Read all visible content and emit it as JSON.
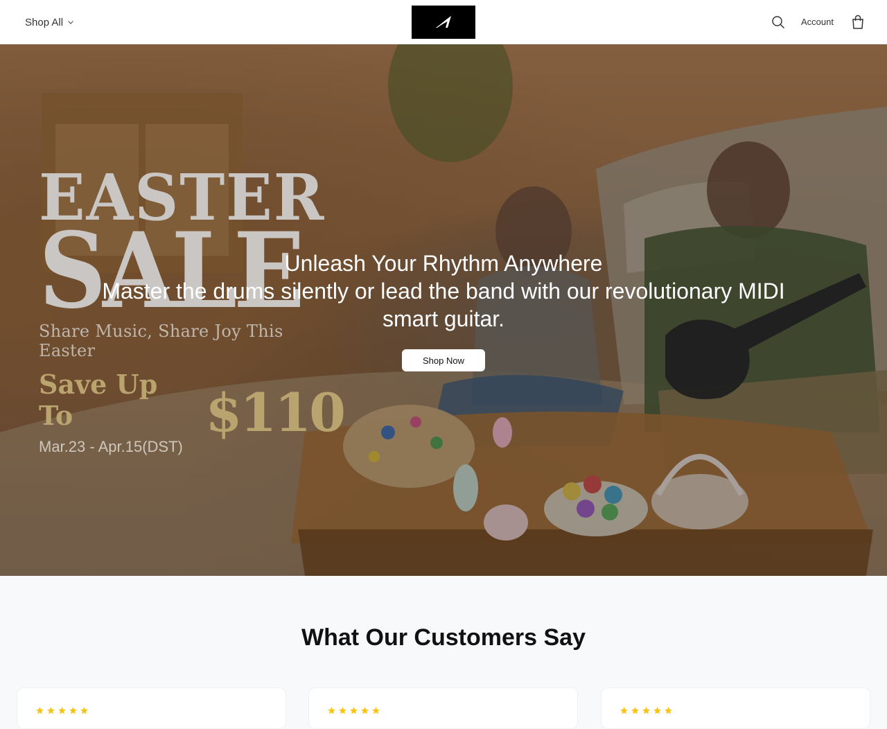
{
  "header": {
    "shop_all_label": "Shop All",
    "account_label": "Account",
    "logo_icon": "brand-logo-icon",
    "search_icon": "search-icon",
    "cart_icon": "shopping-bag-icon"
  },
  "hero": {
    "promo": {
      "line1": "EASTER",
      "line2": "SALE",
      "tagline": "Share Music, Share Joy This Easter",
      "save_label": "Save Up To",
      "save_amount": "$110",
      "dates": "Mar.23 - Apr.15(DST)"
    },
    "title": "Unleash Your Rhythm Anywhere",
    "subtitle": "Master the drums silently or lead the band with our revolutionary MIDI smart guitar.",
    "cta_label": "Shop Now"
  },
  "reviews": {
    "heading": "What Our Customers Say",
    "star_color": "#f5c518",
    "cards": [
      {
        "rating": 5
      },
      {
        "rating": 5
      },
      {
        "rating": 5
      }
    ]
  },
  "colors": {
    "header_bg": "#ffffff",
    "logo_bg": "#000000",
    "promo_gold": "#b9a46f",
    "promo_silver": "#c9c6c3"
  }
}
